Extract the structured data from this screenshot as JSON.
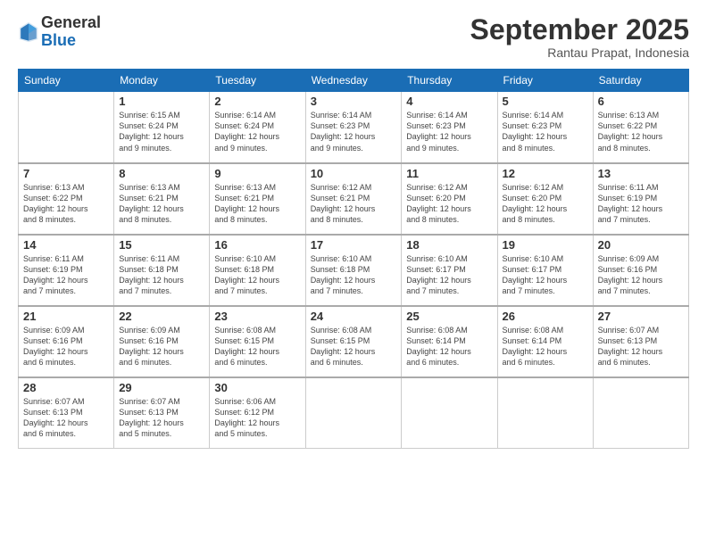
{
  "logo": {
    "general": "General",
    "blue": "Blue"
  },
  "title": "September 2025",
  "location": "Rantau Prapat, Indonesia",
  "headers": [
    "Sunday",
    "Monday",
    "Tuesday",
    "Wednesday",
    "Thursday",
    "Friday",
    "Saturday"
  ],
  "weeks": [
    [
      {
        "day": "",
        "sunrise": "",
        "sunset": "",
        "daylight": ""
      },
      {
        "day": "1",
        "sunrise": "Sunrise: 6:15 AM",
        "sunset": "Sunset: 6:24 PM",
        "daylight": "Daylight: 12 hours and 9 minutes."
      },
      {
        "day": "2",
        "sunrise": "Sunrise: 6:14 AM",
        "sunset": "Sunset: 6:24 PM",
        "daylight": "Daylight: 12 hours and 9 minutes."
      },
      {
        "day": "3",
        "sunrise": "Sunrise: 6:14 AM",
        "sunset": "Sunset: 6:23 PM",
        "daylight": "Daylight: 12 hours and 9 minutes."
      },
      {
        "day": "4",
        "sunrise": "Sunrise: 6:14 AM",
        "sunset": "Sunset: 6:23 PM",
        "daylight": "Daylight: 12 hours and 9 minutes."
      },
      {
        "day": "5",
        "sunrise": "Sunrise: 6:14 AM",
        "sunset": "Sunset: 6:23 PM",
        "daylight": "Daylight: 12 hours and 8 minutes."
      },
      {
        "day": "6",
        "sunrise": "Sunrise: 6:13 AM",
        "sunset": "Sunset: 6:22 PM",
        "daylight": "Daylight: 12 hours and 8 minutes."
      }
    ],
    [
      {
        "day": "7",
        "sunrise": "Sunrise: 6:13 AM",
        "sunset": "Sunset: 6:22 PM",
        "daylight": "Daylight: 12 hours and 8 minutes."
      },
      {
        "day": "8",
        "sunrise": "Sunrise: 6:13 AM",
        "sunset": "Sunset: 6:21 PM",
        "daylight": "Daylight: 12 hours and 8 minutes."
      },
      {
        "day": "9",
        "sunrise": "Sunrise: 6:13 AM",
        "sunset": "Sunset: 6:21 PM",
        "daylight": "Daylight: 12 hours and 8 minutes."
      },
      {
        "day": "10",
        "sunrise": "Sunrise: 6:12 AM",
        "sunset": "Sunset: 6:21 PM",
        "daylight": "Daylight: 12 hours and 8 minutes."
      },
      {
        "day": "11",
        "sunrise": "Sunrise: 6:12 AM",
        "sunset": "Sunset: 6:20 PM",
        "daylight": "Daylight: 12 hours and 8 minutes."
      },
      {
        "day": "12",
        "sunrise": "Sunrise: 6:12 AM",
        "sunset": "Sunset: 6:20 PM",
        "daylight": "Daylight: 12 hours and 8 minutes."
      },
      {
        "day": "13",
        "sunrise": "Sunrise: 6:11 AM",
        "sunset": "Sunset: 6:19 PM",
        "daylight": "Daylight: 12 hours and 7 minutes."
      }
    ],
    [
      {
        "day": "14",
        "sunrise": "Sunrise: 6:11 AM",
        "sunset": "Sunset: 6:19 PM",
        "daylight": "Daylight: 12 hours and 7 minutes."
      },
      {
        "day": "15",
        "sunrise": "Sunrise: 6:11 AM",
        "sunset": "Sunset: 6:18 PM",
        "daylight": "Daylight: 12 hours and 7 minutes."
      },
      {
        "day": "16",
        "sunrise": "Sunrise: 6:10 AM",
        "sunset": "Sunset: 6:18 PM",
        "daylight": "Daylight: 12 hours and 7 minutes."
      },
      {
        "day": "17",
        "sunrise": "Sunrise: 6:10 AM",
        "sunset": "Sunset: 6:18 PM",
        "daylight": "Daylight: 12 hours and 7 minutes."
      },
      {
        "day": "18",
        "sunrise": "Sunrise: 6:10 AM",
        "sunset": "Sunset: 6:17 PM",
        "daylight": "Daylight: 12 hours and 7 minutes."
      },
      {
        "day": "19",
        "sunrise": "Sunrise: 6:10 AM",
        "sunset": "Sunset: 6:17 PM",
        "daylight": "Daylight: 12 hours and 7 minutes."
      },
      {
        "day": "20",
        "sunrise": "Sunrise: 6:09 AM",
        "sunset": "Sunset: 6:16 PM",
        "daylight": "Daylight: 12 hours and 7 minutes."
      }
    ],
    [
      {
        "day": "21",
        "sunrise": "Sunrise: 6:09 AM",
        "sunset": "Sunset: 6:16 PM",
        "daylight": "Daylight: 12 hours and 6 minutes."
      },
      {
        "day": "22",
        "sunrise": "Sunrise: 6:09 AM",
        "sunset": "Sunset: 6:16 PM",
        "daylight": "Daylight: 12 hours and 6 minutes."
      },
      {
        "day": "23",
        "sunrise": "Sunrise: 6:08 AM",
        "sunset": "Sunset: 6:15 PM",
        "daylight": "Daylight: 12 hours and 6 minutes."
      },
      {
        "day": "24",
        "sunrise": "Sunrise: 6:08 AM",
        "sunset": "Sunset: 6:15 PM",
        "daylight": "Daylight: 12 hours and 6 minutes."
      },
      {
        "day": "25",
        "sunrise": "Sunrise: 6:08 AM",
        "sunset": "Sunset: 6:14 PM",
        "daylight": "Daylight: 12 hours and 6 minutes."
      },
      {
        "day": "26",
        "sunrise": "Sunrise: 6:08 AM",
        "sunset": "Sunset: 6:14 PM",
        "daylight": "Daylight: 12 hours and 6 minutes."
      },
      {
        "day": "27",
        "sunrise": "Sunrise: 6:07 AM",
        "sunset": "Sunset: 6:13 PM",
        "daylight": "Daylight: 12 hours and 6 minutes."
      }
    ],
    [
      {
        "day": "28",
        "sunrise": "Sunrise: 6:07 AM",
        "sunset": "Sunset: 6:13 PM",
        "daylight": "Daylight: 12 hours and 6 minutes."
      },
      {
        "day": "29",
        "sunrise": "Sunrise: 6:07 AM",
        "sunset": "Sunset: 6:13 PM",
        "daylight": "Daylight: 12 hours and 5 minutes."
      },
      {
        "day": "30",
        "sunrise": "Sunrise: 6:06 AM",
        "sunset": "Sunset: 6:12 PM",
        "daylight": "Daylight: 12 hours and 5 minutes."
      },
      {
        "day": "",
        "sunrise": "",
        "sunset": "",
        "daylight": ""
      },
      {
        "day": "",
        "sunrise": "",
        "sunset": "",
        "daylight": ""
      },
      {
        "day": "",
        "sunrise": "",
        "sunset": "",
        "daylight": ""
      },
      {
        "day": "",
        "sunrise": "",
        "sunset": "",
        "daylight": ""
      }
    ]
  ]
}
